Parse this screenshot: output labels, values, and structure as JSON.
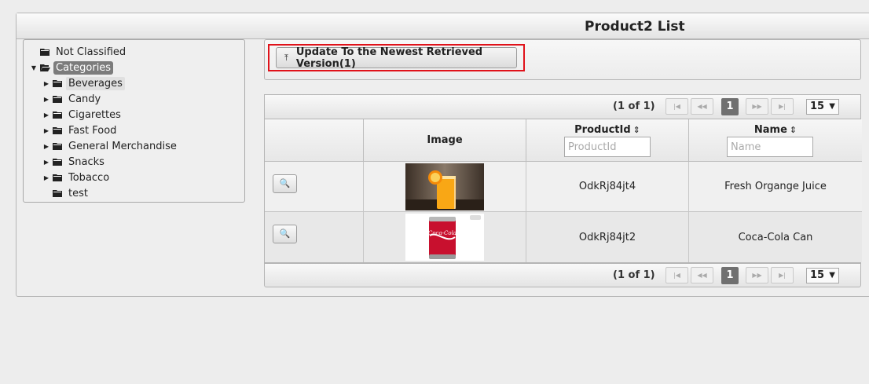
{
  "panel": {
    "title": "Product2 List"
  },
  "tree": {
    "nodes": [
      {
        "label": "Not Classified"
      },
      {
        "label": "Categories"
      },
      {
        "label": "Beverages"
      },
      {
        "label": "Candy"
      },
      {
        "label": "Cigarettes"
      },
      {
        "label": "Fast Food"
      },
      {
        "label": "General Merchandise"
      },
      {
        "label": "Snacks"
      },
      {
        "label": "Tobacco"
      },
      {
        "label": "test"
      }
    ]
  },
  "toolbar": {
    "update_label": "Update To the Newest Retrieved Version(1)"
  },
  "paginator": {
    "count": "(1 of 1)",
    "current_page": "1",
    "rows_per_page": "15"
  },
  "table": {
    "headers": {
      "image": "Image",
      "productid": "ProductId",
      "name": "Name"
    },
    "filters": {
      "productid_placeholder": "ProductId",
      "name_placeholder": "Name"
    },
    "rows": [
      {
        "productid": "OdkRj84jt4",
        "name": "Fresh Organge Juice",
        "image_icon": "orange-juice-image"
      },
      {
        "productid": "OdkRj84jt2",
        "name": "Coca-Cola Can",
        "image_icon": "coca-cola-can-image"
      }
    ]
  },
  "colors": {
    "highlight": "#e0121a",
    "selected_node": "#7c7c7c"
  }
}
